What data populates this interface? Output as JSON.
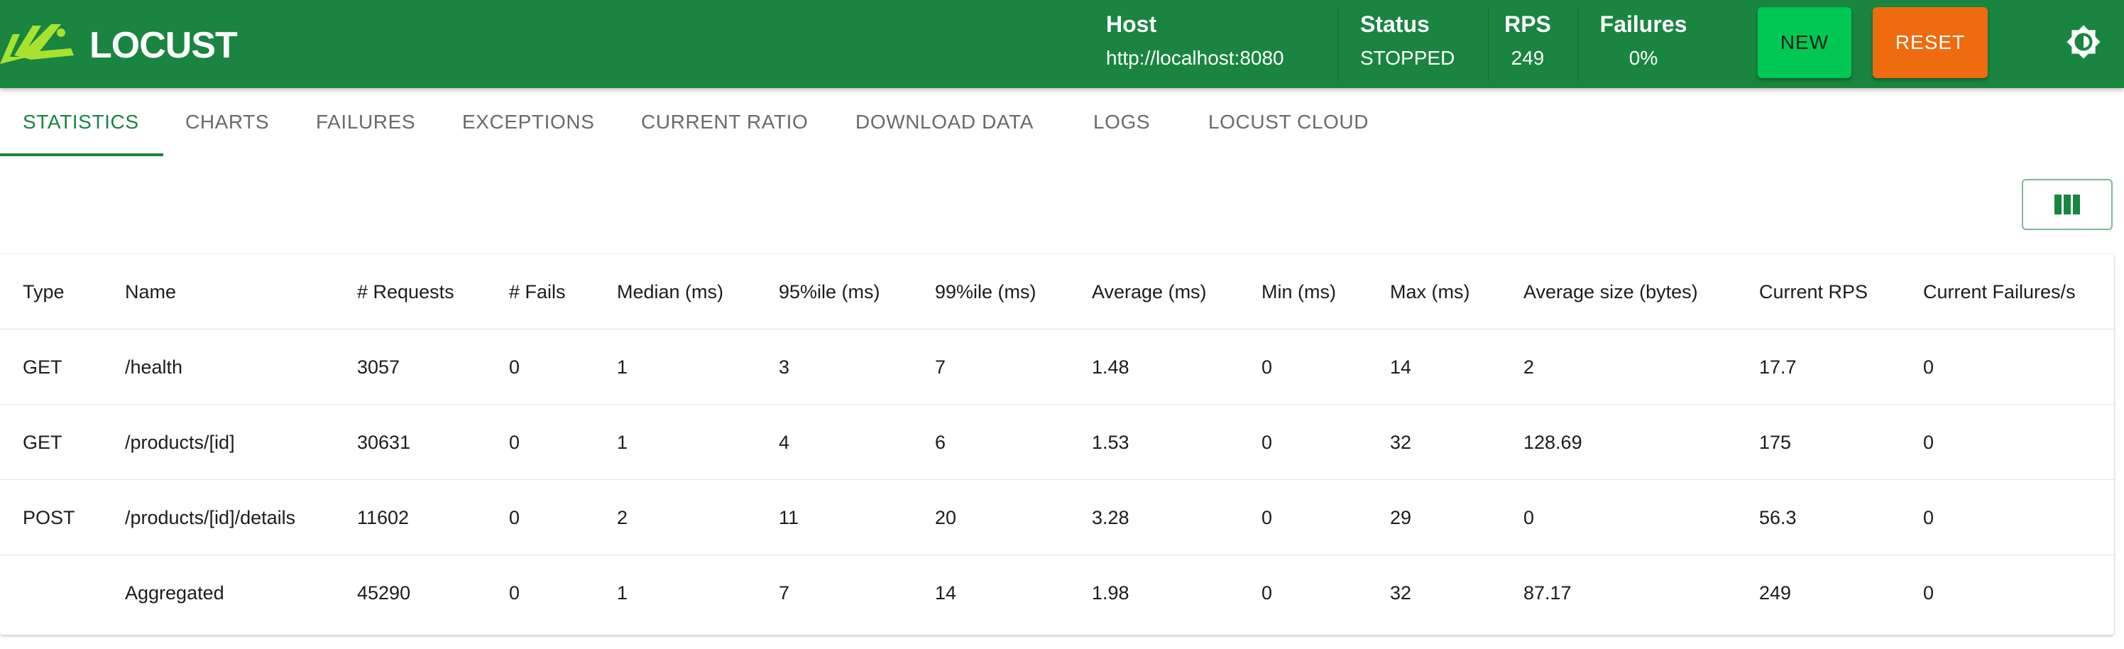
{
  "app": {
    "name": "LOCUST",
    "brand_color": "#198540"
  },
  "header": {
    "host_label": "Host",
    "host_value": "http://localhost:8080",
    "status_label": "Status",
    "status_value": "STOPPED",
    "rps_label": "RPS",
    "rps_value": "249",
    "failures_label": "Failures",
    "failures_value": "0%",
    "new_button": "NEW",
    "reset_button": "RESET",
    "theme_icon": "brightness-icon"
  },
  "tabs": [
    {
      "label": "STATISTICS",
      "active": true
    },
    {
      "label": "CHARTS",
      "active": false
    },
    {
      "label": "FAILURES",
      "active": false
    },
    {
      "label": "EXCEPTIONS",
      "active": false
    },
    {
      "label": "CURRENT RATIO",
      "active": false
    },
    {
      "label": "DOWNLOAD DATA",
      "active": false
    },
    {
      "label": "LOGS",
      "active": false
    },
    {
      "label": "LOCUST CLOUD",
      "active": false
    }
  ],
  "toolbar": {
    "columns_icon": "view-columns-icon"
  },
  "table": {
    "columns": [
      "Type",
      "Name",
      "# Requests",
      "# Fails",
      "Median (ms)",
      "95%ile (ms)",
      "99%ile (ms)",
      "Average (ms)",
      "Min (ms)",
      "Max (ms)",
      "Average size (bytes)",
      "Current RPS",
      "Current Failures/s"
    ],
    "rows": [
      [
        "GET",
        "/health",
        "3057",
        "0",
        "1",
        "3",
        "7",
        "1.48",
        "0",
        "14",
        "2",
        "17.7",
        "0"
      ],
      [
        "GET",
        "/products/[id]",
        "30631",
        "0",
        "1",
        "4",
        "6",
        "1.53",
        "0",
        "32",
        "128.69",
        "175",
        "0"
      ],
      [
        "POST",
        "/products/[id]/details",
        "11602",
        "0",
        "2",
        "11",
        "20",
        "3.28",
        "0",
        "29",
        "0",
        "56.3",
        "0"
      ],
      [
        "",
        "Aggregated",
        "45290",
        "0",
        "1",
        "7",
        "14",
        "1.98",
        "0",
        "32",
        "87.17",
        "249",
        "0"
      ]
    ]
  }
}
